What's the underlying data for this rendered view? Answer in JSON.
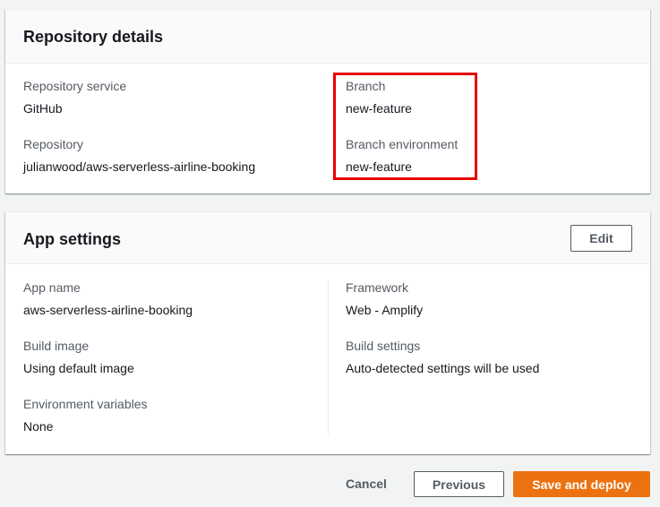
{
  "repository_details": {
    "title": "Repository details",
    "repository_service_label": "Repository service",
    "repository_service_value": "GitHub",
    "repository_label": "Repository",
    "repository_value": "julianwood/aws-serverless-airline-booking",
    "branch_label": "Branch",
    "branch_value": "new-feature",
    "branch_environment_label": "Branch environment",
    "branch_environment_value": "new-feature",
    "highlight_color": "#e60000"
  },
  "app_settings": {
    "title": "App settings",
    "edit_label": "Edit",
    "app_name_label": "App name",
    "app_name_value": "aws-serverless-airline-booking",
    "build_image_label": "Build image",
    "build_image_value": "Using default image",
    "environment_variables_label": "Environment variables",
    "environment_variables_value": "None",
    "framework_label": "Framework",
    "framework_value": "Web - Amplify",
    "build_settings_label": "Build settings",
    "build_settings_value": "Auto-detected settings will be used"
  },
  "footer": {
    "cancel_label": "Cancel",
    "previous_label": "Previous",
    "save_deploy_label": "Save and deploy"
  },
  "colors": {
    "primary_button": "#ec7211",
    "background": "#f2f3f3"
  }
}
